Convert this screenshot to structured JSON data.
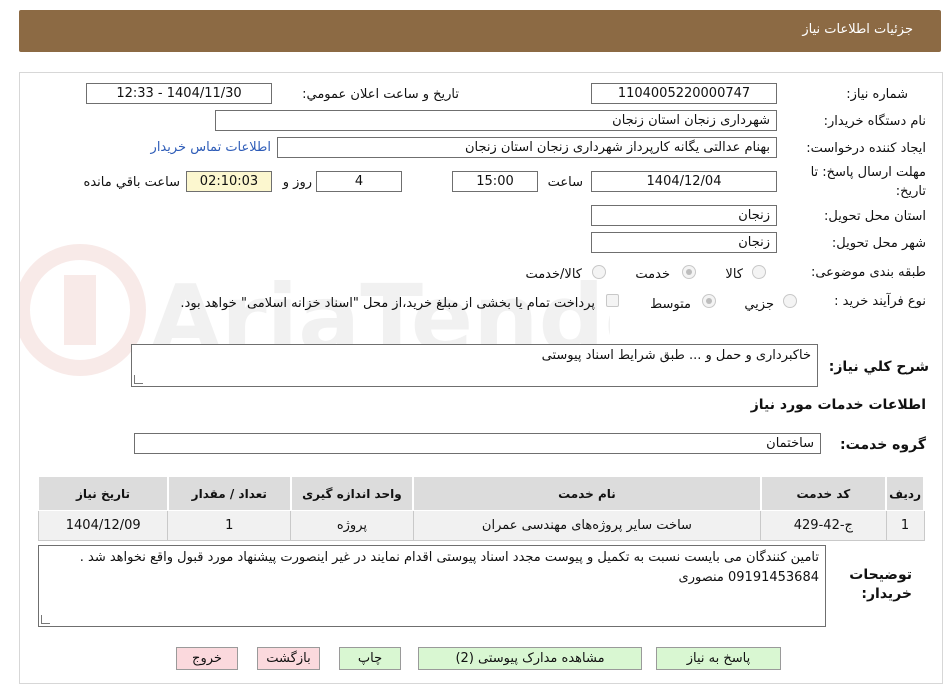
{
  "header": {
    "title": "جزئیات اطلاعات نیاز"
  },
  "form": {
    "need_number_label": "شماره نیاز:",
    "need_number": "1104005220000747",
    "announce_label": "تاریخ و ساعت اعلان عمومي:",
    "announce_value": "1404/11/30 - 12:33",
    "buyer_org_label": "نام دستگاه خريدار:",
    "buyer_org": "شهرداری زنجان استان زنجان",
    "creator_label": "ايجاد كننده درخواست:",
    "creator": "بهنام عدالتی یگانه کارپرداز شهرداری زنجان استان زنجان",
    "contact_link": "اطلاعات تماس خريدار",
    "deadline_label_line1": "مهلت ارسال پاسخ: تا",
    "deadline_label_line2": "تاريخ:",
    "deadline_date": "1404/12/04",
    "time_label": "ساعت",
    "deadline_time": "15:00",
    "days_value": "4",
    "days_label": "روز و",
    "remaining_time": "02:10:03",
    "remaining_label": "ساعت باقي مانده",
    "province_label": "استان محل تحويل:",
    "province": "زنجان",
    "city_label": "شهر محل تحويل:",
    "city": "زنجان",
    "category_label": "طبقه بندی موضوعی:",
    "category_options": [
      "كالا",
      "خدمت",
      "كالا/خدمت"
    ],
    "process_label": "نوع فرآيند خريد :",
    "process_options": [
      "جزيي",
      "متوسط"
    ],
    "payment_note": "پرداخت تمام يا بخشی از مبلغ خريد،از محل \"اسناد خزانه اسلامی\" خواهد بود.",
    "description_label": "شرح كلي نياز:",
    "description": "خاکبرداری و حمل و ... طبق شرایط اسناد پیوستی",
    "services_heading": "اطلاعات خدمات مورد نياز",
    "service_group_label": "گروه خدمت:",
    "service_group": "ساختمان"
  },
  "table": {
    "headers": [
      "رديف",
      "كد خدمت",
      "نام خدمت",
      "واحد اندازه گيری",
      "تعداد / مقدار",
      "تاريخ نياز"
    ],
    "rows": [
      [
        "1",
        "ج-42-429",
        "ساخت سایر پروژه‌های مهندسی عمران",
        "پروژه",
        "1",
        "1404/12/09"
      ]
    ]
  },
  "buyer_notes": {
    "label_line1": "توضيحات",
    "label_line2": "خريدار:",
    "text": "تامین کنندگان می بایست نسبت به تکمیل و پیوست مجدد اسناد پیوستی اقدام نمایند در غیر اینصورت پیشنهاد مورد قبول واقع نخواهد شد . 09191453684 منصوری"
  },
  "buttons": {
    "reply": "پاسخ به نياز",
    "attachments": "مشاهده مدارک پیوستی (2)",
    "print": "چاپ",
    "back": "بازگشت",
    "exit": "خروج"
  },
  "colors": {
    "header_bg": "#8c6a44",
    "link": "#2f5db8",
    "green_button": "#d9f7d2",
    "pink_button": "#fbd9dd",
    "remaining_bg": "#fcf7cf"
  },
  "watermark": "AriaTender.neT"
}
